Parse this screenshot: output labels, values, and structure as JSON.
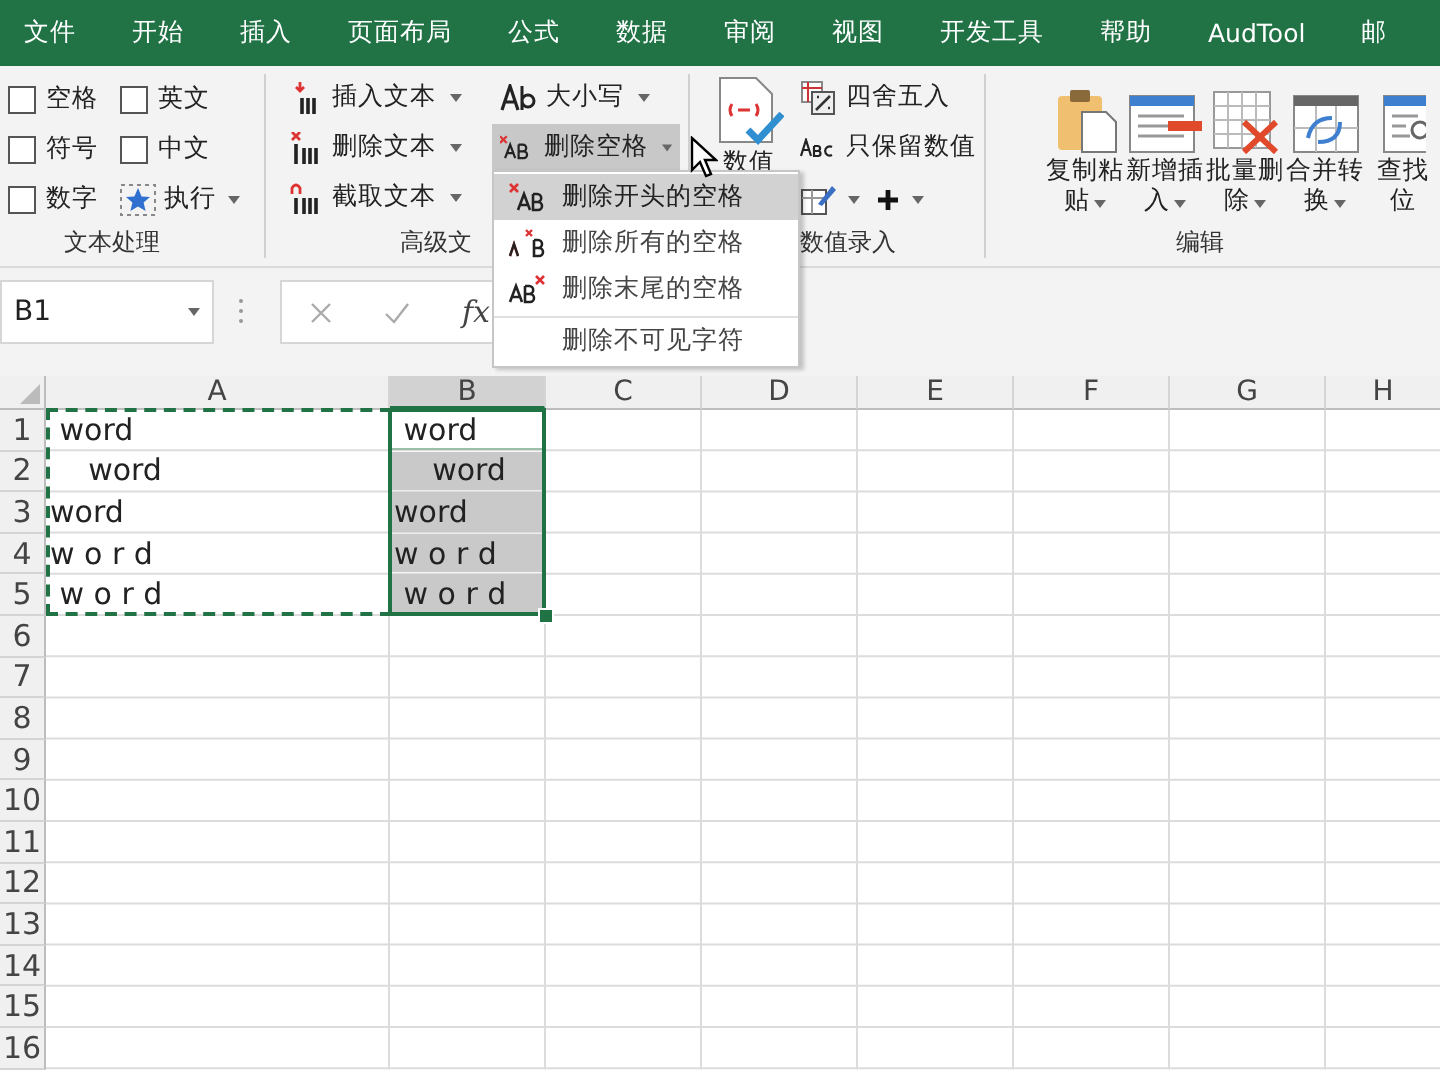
{
  "tabs": [
    {
      "label": "文件"
    },
    {
      "label": "开始"
    },
    {
      "label": "插入"
    },
    {
      "label": "页面布局"
    },
    {
      "label": "公式"
    },
    {
      "label": "数据"
    },
    {
      "label": "审阅"
    },
    {
      "label": "视图"
    },
    {
      "label": "开发工具"
    },
    {
      "label": "帮助"
    },
    {
      "label": "AudTool"
    },
    {
      "label": "邮"
    }
  ],
  "ribbon": {
    "groups": [
      {
        "kind": "checks",
        "label": "文本处理",
        "items": [
          {
            "kind": "checkbox",
            "label": "空格",
            "checked": false
          },
          {
            "kind": "checkbox",
            "label": "英文",
            "checked": false
          },
          {
            "kind": "checkbox",
            "label": "符号",
            "checked": false
          },
          {
            "kind": "checkbox",
            "label": "中文",
            "checked": false
          },
          {
            "kind": "checkbox",
            "label": "数字",
            "checked": false
          },
          {
            "kind": "menu",
            "label": "执行"
          }
        ]
      },
      {
        "kind": "columns",
        "label": "高级文",
        "columns": [
          [
            {
              "kind": "insert",
              "label": "插入文本",
              "pressed": false
            },
            {
              "kind": "delete",
              "label": "删除文本",
              "pressed": false
            },
            {
              "kind": "extract",
              "label": "截取文本",
              "pressed": false
            }
          ],
          [
            {
              "kind": "case",
              "label": "大小写",
              "pressed": false
            },
            {
              "kind": "trim",
              "label": "删除空格",
              "pressed": true
            }
          ]
        ]
      },
      {
        "kind": "numeric",
        "label": "数值录入",
        "big": {
          "label": "数值"
        },
        "items": [
          {
            "kind": "round",
            "label": "四舍五入"
          },
          {
            "kind": "abc",
            "label": "只保留数值"
          }
        ],
        "tools": [
          {
            "kind": "edit"
          },
          {
            "kind": "plus"
          }
        ]
      },
      {
        "kind": "big",
        "label": "编辑",
        "buttons": [
          {
            "kind": "paste",
            "lines": [
              "复制粘",
              "贴"
            ],
            "dropdown": true
          },
          {
            "kind": "insert-row",
            "lines": [
              "新增插",
              "入"
            ],
            "dropdown": true
          },
          {
            "kind": "delete-grid",
            "lines": [
              "批量删",
              "除"
            ],
            "dropdown": true
          },
          {
            "kind": "convert",
            "lines": [
              "合并转",
              "换"
            ],
            "dropdown": true
          },
          {
            "kind": "find",
            "lines": [
              "查找",
              "位"
            ],
            "dropdown": false
          }
        ]
      }
    ]
  },
  "menu": {
    "items": [
      {
        "kind": "leading",
        "label": "删除开头的空格",
        "hovered": true,
        "separator_before": false
      },
      {
        "kind": "all",
        "label": "删除所有的空格",
        "hovered": false,
        "separator_before": false
      },
      {
        "kind": "trailing",
        "label": "删除末尾的空格",
        "hovered": false,
        "separator_before": false
      },
      {
        "kind": "invisible",
        "label": "删除不可见字符",
        "hovered": false,
        "separator_before": true
      }
    ]
  },
  "formula_bar": {
    "name_box": "B1",
    "function_label": "fx"
  },
  "sheet": {
    "columns": [
      {
        "label": "A",
        "selected": false
      },
      {
        "label": "B",
        "selected": true
      },
      {
        "label": "C",
        "selected": false
      },
      {
        "label": "D",
        "selected": false
      },
      {
        "label": "E",
        "selected": false
      },
      {
        "label": "F",
        "selected": false
      },
      {
        "label": "G",
        "selected": false
      },
      {
        "label": "H",
        "selected": false
      }
    ],
    "rows": [
      {
        "label": "1",
        "cells": [
          {
            "text": " word",
            "selected": false,
            "active": false,
            "copied": true
          },
          {
            "text": " word",
            "selected": true,
            "active": true,
            "copied": false
          }
        ]
      },
      {
        "label": "2",
        "cells": [
          {
            "text": "    word",
            "selected": false,
            "active": false,
            "copied": true
          },
          {
            "text": "    word",
            "selected": true,
            "active": false,
            "copied": false
          }
        ]
      },
      {
        "label": "3",
        "cells": [
          {
            "text": "word",
            "selected": false,
            "active": false,
            "copied": true
          },
          {
            "text": "word",
            "selected": true,
            "active": false,
            "copied": false
          }
        ]
      },
      {
        "label": "4",
        "cells": [
          {
            "text": "w o r d",
            "selected": false,
            "active": false,
            "copied": true
          },
          {
            "text": "w o r d",
            "selected": true,
            "active": false,
            "copied": false
          }
        ]
      },
      {
        "label": "5",
        "cells": [
          {
            "text": " w o r d",
            "selected": false,
            "active": false,
            "copied": true
          },
          {
            "text": " w o r d",
            "selected": true,
            "active": false,
            "copied": false
          }
        ]
      },
      {
        "label": "6"
      },
      {
        "label": "7"
      },
      {
        "label": "8"
      },
      {
        "label": "9"
      },
      {
        "label": "10"
      },
      {
        "label": "11"
      },
      {
        "label": "12"
      },
      {
        "label": "13"
      },
      {
        "label": "14"
      },
      {
        "label": "15"
      },
      {
        "label": "16"
      }
    ]
  }
}
